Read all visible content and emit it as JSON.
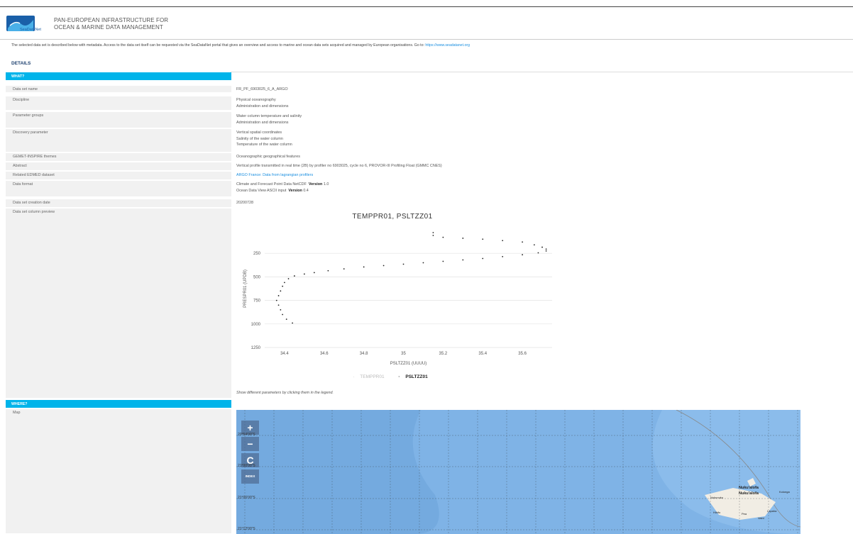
{
  "header": {
    "brand": "SeaDataNet",
    "title_line1": "PAN-EUROPEAN INFRASTRUCTURE FOR",
    "title_line2": "OCEAN & MARINE DATA MANAGEMENT"
  },
  "intro": {
    "text": "The selected data set is described below with metadata. Access to the data set itself can be requested via the SeaDataNet portal that gives an overview and access to marine and ocean data sets acquired and managed by European organisations. Go to: ",
    "link": "https://www.seadatanet.org"
  },
  "details_heading": "DETAILS",
  "sections": {
    "what": "WHAT?",
    "where": "WHERE?"
  },
  "rows": {
    "dataset_name": {
      "label": "Data set name",
      "value": "FR_PF_6903025_6_A_ARGO"
    },
    "discipline": {
      "label": "Discipline",
      "values": [
        "Physical oceanography",
        "Administration and dimensions"
      ]
    },
    "parameter_groups": {
      "label": "Parameter groups",
      "values": [
        "Water column temperature and salinity",
        "Administration and dimensions"
      ]
    },
    "discovery_parameter": {
      "label": "Discovery parameter",
      "values": [
        "Vertical spatial coordinates",
        "Salinity of the water column",
        "Temperature of the water column"
      ]
    },
    "gemet": {
      "label": "GEMET-INSPIRE themes",
      "value": "Oceanographic geographical features"
    },
    "abstract": {
      "label": "Abstract",
      "value": "Vertical profile transmitted in real time (2B) by profiler no 6903025, cycle no 6, PROVOR-III Profiling Float (GMMC CNES)"
    },
    "edmed": {
      "label": "Related EDMED dataset",
      "value": "ARGO France: Data from lagrangian profilers"
    },
    "data_format": {
      "label": "Data format",
      "f1_name": "Climate and Forecast Point Data NetCDF",
      "f1_version_label": "Version",
      "f1_version": "1.0",
      "f2_name": "Ocean Data View ASCII input",
      "f2_version_label": "Version",
      "f2_version": "0.4"
    },
    "creation_date": {
      "label": "Data set creation date",
      "value": "20200728"
    },
    "column_preview": {
      "label": "Data set column preview"
    },
    "map": {
      "label": "Map"
    }
  },
  "chart_data": {
    "type": "scatter",
    "title": "TEMPPR01, PSLTZZ01",
    "xlabel": "PSLTZZ01 (UUUU)",
    "ylabel": "PRESPR01 (UPDB)",
    "xlim": [
      34.3,
      35.75
    ],
    "ylim": [
      1250,
      0
    ],
    "x_ticks": [
      "34.4",
      "34.6",
      "34.8",
      "35",
      "35.2",
      "35.4",
      "35.6"
    ],
    "y_ticks": [
      "250",
      "500",
      "750",
      "1000",
      "1250"
    ],
    "legend": [
      "TEMPPR01",
      "PSLTZZ01"
    ],
    "active_series": "PSLTZZ01",
    "series": [
      {
        "name": "PSLTZZ01",
        "points": [
          [
            35.15,
            30
          ],
          [
            35.15,
            60
          ],
          [
            35.2,
            80
          ],
          [
            35.3,
            90
          ],
          [
            35.4,
            100
          ],
          [
            35.5,
            115
          ],
          [
            35.6,
            130
          ],
          [
            35.66,
            160
          ],
          [
            35.7,
            185
          ],
          [
            35.72,
            205
          ],
          [
            35.72,
            225
          ],
          [
            35.68,
            245
          ],
          [
            35.6,
            265
          ],
          [
            35.5,
            285
          ],
          [
            35.4,
            305
          ],
          [
            35.3,
            320
          ],
          [
            35.2,
            335
          ],
          [
            35.1,
            350
          ],
          [
            35.0,
            365
          ],
          [
            34.9,
            380
          ],
          [
            34.8,
            395
          ],
          [
            34.7,
            415
          ],
          [
            34.62,
            435
          ],
          [
            34.55,
            455
          ],
          [
            34.5,
            470
          ],
          [
            34.45,
            490
          ],
          [
            34.42,
            520
          ],
          [
            34.4,
            560
          ],
          [
            34.39,
            600
          ],
          [
            34.38,
            650
          ],
          [
            34.37,
            700
          ],
          [
            34.36,
            750
          ],
          [
            34.37,
            800
          ],
          [
            34.38,
            850
          ],
          [
            34.39,
            900
          ],
          [
            34.41,
            950
          ],
          [
            34.44,
            990
          ]
        ]
      }
    ]
  },
  "hint": "Show different parameters by clicking them in the legend.",
  "map": {
    "controls": {
      "zoom_in": "+",
      "zoom_out": "−",
      "reset": "C",
      "index": "INDEX"
    },
    "lat_labels": [
      "20°54'00\"S",
      "21°00'00\"S",
      "21°06'00\"S",
      "21°12'00\"S"
    ],
    "places": [
      "Nuku'alofa",
      "Nuku'alofa",
      "Nukunuku",
      "Kolonga",
      "Hihifo",
      "Pea",
      "Lapaha",
      "Vaini"
    ]
  }
}
